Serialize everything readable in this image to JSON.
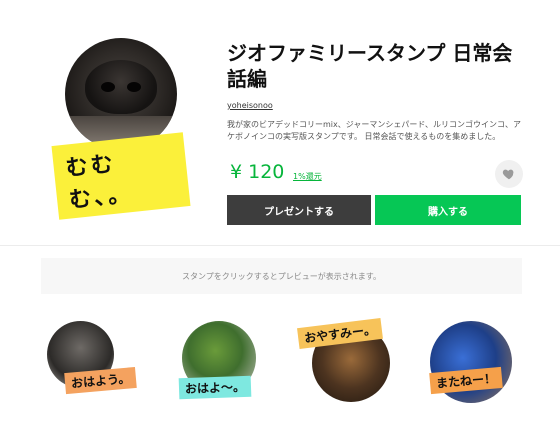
{
  "product": {
    "title": "ジオファミリースタンプ 日常会話編",
    "author": "yoheisonoo",
    "description": "我が家のビアデッドコリーmix、ジャーマンシェパード、ルリコンゴウインコ、アケボノインコの実写版スタンプです。 日常会話で使えるものを集めました。",
    "main_label": "むむむ、。",
    "price": "¥ 120",
    "discount": "1%還元"
  },
  "actions": {
    "gift_label": "プレゼントする",
    "buy_label": "購入する"
  },
  "preview": {
    "hint": "スタンプをクリックするとプレビューが表示されます。"
  },
  "stickers": [
    {
      "label": "おはよう。"
    },
    {
      "label": "おはよ〜。"
    },
    {
      "label": "おやすみー。"
    },
    {
      "label": "またねー！"
    }
  ],
  "colors": {
    "accent_green": "#06c755",
    "gift_button": "#3d3d3d",
    "main_label_bg": "#fbf03a"
  },
  "icons": {
    "like": "heart-icon"
  }
}
